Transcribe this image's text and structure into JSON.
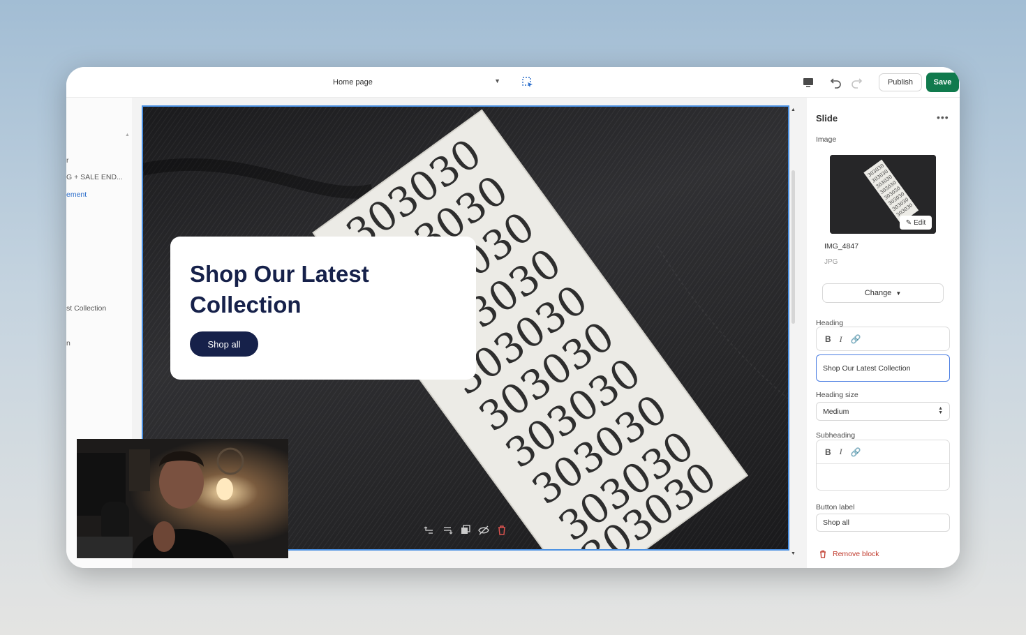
{
  "topbar": {
    "page_select": "Home page",
    "publish_label": "Publish",
    "save_label": "Save",
    "icons": [
      "inspect-icon",
      "desktop-icon",
      "undo-icon",
      "redo-icon"
    ],
    "save_color": "#107a4d"
  },
  "sidebar": {
    "items": [
      {
        "label": "r"
      },
      {
        "label": "G + SALE END..."
      },
      {
        "label": "ement"
      },
      {
        "label": "st Collection"
      },
      {
        "label": "n"
      }
    ]
  },
  "preview": {
    "heading": "Shop Our Latest Collection",
    "button_label": "Shop all",
    "label_text": "303030",
    "accent_color": "#16214a"
  },
  "panel": {
    "title": "Slide",
    "image_label": "Image",
    "edit_label": "Edit",
    "image_name": "IMG_4847",
    "image_type": "JPG",
    "change_label": "Change",
    "heading_label": "Heading",
    "heading_value": "Shop Our Latest Collection",
    "heading_size_label": "Heading size",
    "heading_size_value": "Medium",
    "subheading_label": "Subheading",
    "button_label_label": "Button label",
    "button_label_value": "Shop all",
    "remove_block_label": "Remove block"
  }
}
